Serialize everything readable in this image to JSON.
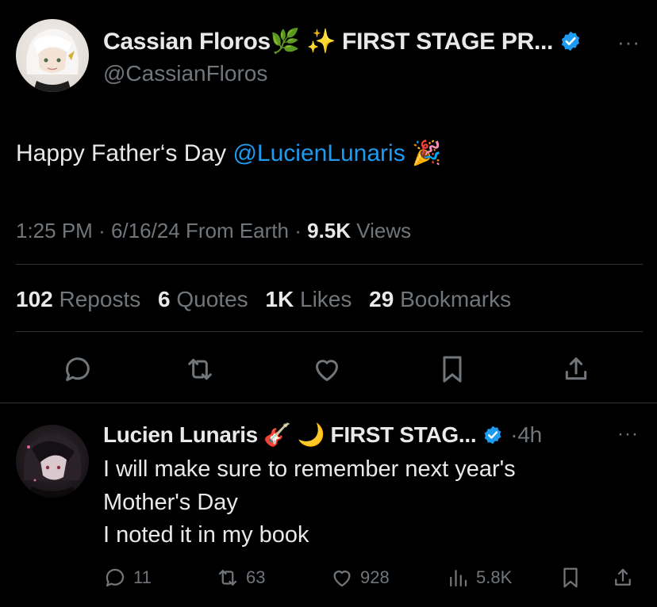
{
  "main_tweet": {
    "author_name": "Cassian Floros🌿 ✨ FIRST STAGE PR...",
    "handle": "@CassianFloros",
    "more_label": "···",
    "text_plain": "Happy Father‘s Day ",
    "text_mention": "@LucienLunaris",
    "text_emoji": "🎉",
    "time": "1:25 PM",
    "date": "6/16/24",
    "source": "From Earth",
    "views_count": "9.5K",
    "views_label": "Views",
    "stats": {
      "reposts_count": "102",
      "reposts_label": "Reposts",
      "quotes_count": "6",
      "quotes_label": "Quotes",
      "likes_count": "1K",
      "likes_label": "Likes",
      "bookmarks_count": "29",
      "bookmarks_label": "Bookmarks"
    }
  },
  "reply": {
    "author_name": "Lucien Lunaris 🎸 🌙 FIRST STAG...",
    "time_ago": "4h",
    "more_label": "···",
    "lines": [
      "I will make sure to remember next year's",
      "Mother's Day",
      "I noted it in my book"
    ],
    "actions": {
      "replies": "11",
      "reposts": "63",
      "likes": "928",
      "views": "5.8K"
    }
  },
  "colors": {
    "background": "#000000",
    "text": "#e7e9ea",
    "muted": "#71767b",
    "link": "#1d9bf0",
    "divider": "#2f3336"
  }
}
